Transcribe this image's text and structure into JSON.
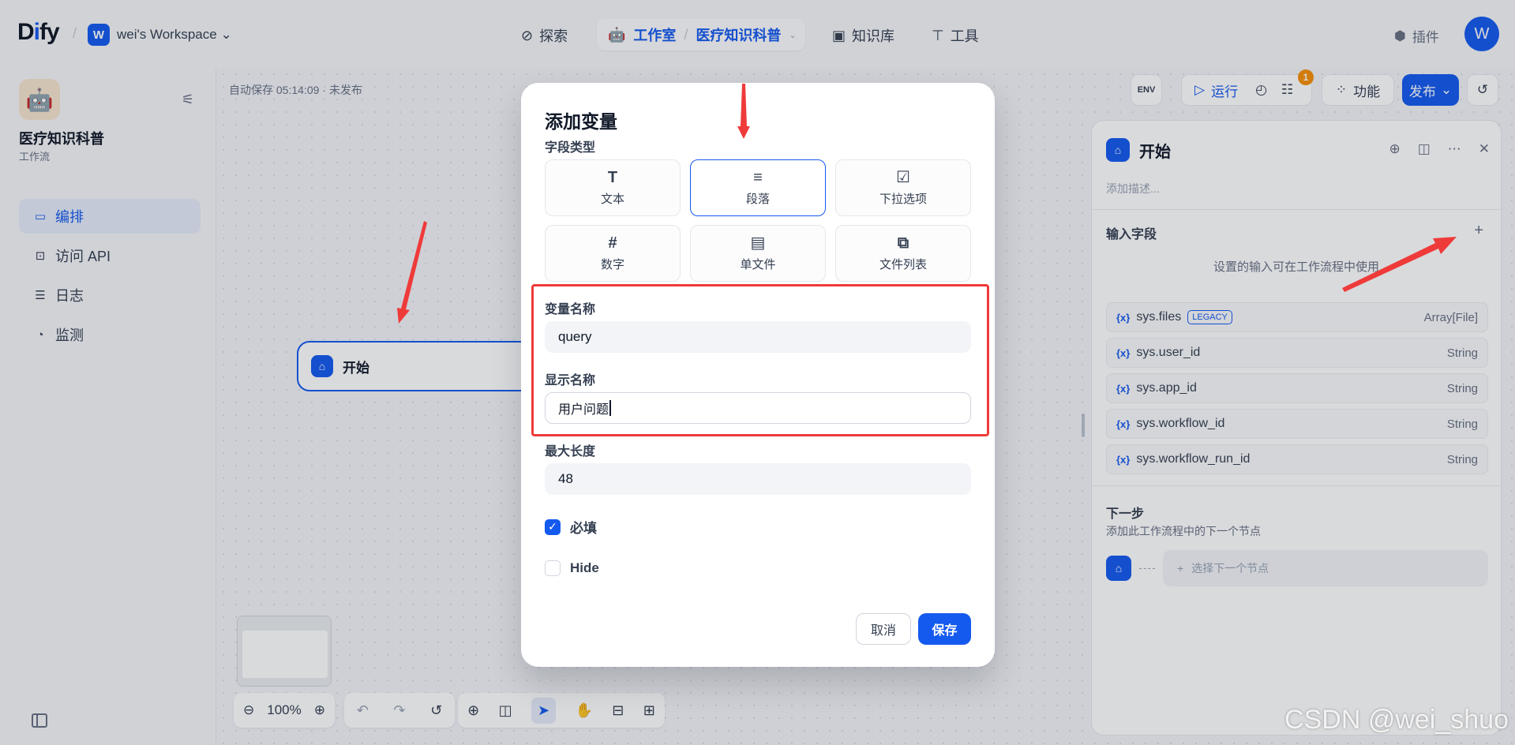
{
  "header": {
    "logo_text": "Dify",
    "workspace_initial": "W",
    "workspace_name": "wei's Workspace",
    "nav_explore": "探索",
    "nav_studio": "工作室",
    "nav_app": "医疗知识科普",
    "nav_knowledge": "知识库",
    "nav_tools": "工具",
    "plugins": "插件",
    "avatar_initial": "W"
  },
  "sidebar": {
    "app_name": "医疗知识科普",
    "app_type": "工作流",
    "items": [
      {
        "label": "编排",
        "icon": "layout-icon"
      },
      {
        "label": "访问 API",
        "icon": "terminal-icon"
      },
      {
        "label": "日志",
        "icon": "log-icon"
      },
      {
        "label": "监测",
        "icon": "monitor-icon"
      }
    ]
  },
  "canvas": {
    "autosave": "自动保存 05:14:09 · 未发布",
    "start_node": "开始",
    "zoom": "100%"
  },
  "actions": {
    "env": "ENV",
    "run": "运行",
    "features": "功能",
    "publish": "发布",
    "checklist_count": "1"
  },
  "panel": {
    "title": "开始",
    "desc_placeholder": "添加描述...",
    "input_fields": "输入字段",
    "hint": "设置的输入可在工作流程中使用",
    "vars": [
      {
        "name": "sys.files",
        "type": "Array[File]",
        "badge": "LEGACY"
      },
      {
        "name": "sys.user_id",
        "type": "String"
      },
      {
        "name": "sys.app_id",
        "type": "String"
      },
      {
        "name": "sys.workflow_id",
        "type": "String"
      },
      {
        "name": "sys.workflow_run_id",
        "type": "String"
      }
    ],
    "next_step": "下一步",
    "next_step_desc": "添加此工作流程中的下一个节点",
    "select_next": "选择下一个节点"
  },
  "modal": {
    "title": "添加变量",
    "field_type_label": "字段类型",
    "types": [
      {
        "label": "文本",
        "icon": "T"
      },
      {
        "label": "段落",
        "icon": "≡"
      },
      {
        "label": "下拉选项",
        "icon": "☑"
      },
      {
        "label": "数字",
        "icon": "#"
      },
      {
        "label": "单文件",
        "icon": "▤"
      },
      {
        "label": "文件列表",
        "icon": "⧉"
      }
    ],
    "selected_type": "段落",
    "var_name_label": "变量名称",
    "var_name_value": "query",
    "display_name_label": "显示名称",
    "display_name_value": "用户问题",
    "max_length_label": "最大长度",
    "max_length_value": "48",
    "required_label": "必填",
    "required_checked": true,
    "hide_label": "Hide",
    "hide_checked": false,
    "cancel": "取消",
    "save": "保存"
  },
  "watermark": "CSDN @wei_shuo",
  "colors": {
    "accent": "#155aef",
    "annotation": "#ef3a3a"
  }
}
